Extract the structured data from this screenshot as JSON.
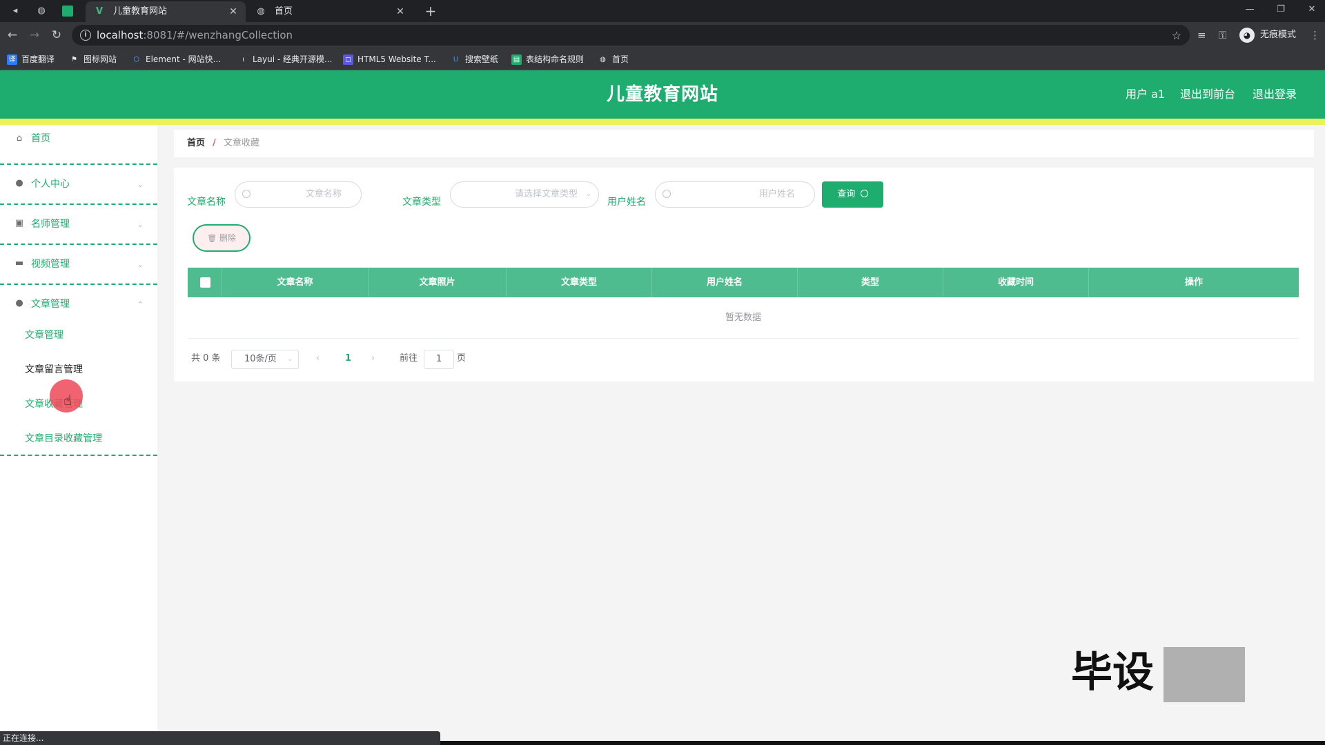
{
  "browser": {
    "tabs": [
      {
        "title": "儿童教育网站",
        "active": true,
        "icon": "vue-icon"
      },
      {
        "title": "首页",
        "active": false,
        "icon": "globe-icon"
      }
    ],
    "url_host": "localhost",
    "url_path": ":8081/#/wenzhangCollection",
    "incognito_label": "无痕模式",
    "bookmarks": [
      "百度翻译",
      "图标网站",
      "Element - 网站快...",
      "Layui - 经典开源模...",
      "HTML5 Website T...",
      "搜索壁纸",
      "表结构命名规则",
      "首页"
    ],
    "status_text": "正在连接..."
  },
  "header": {
    "title": "儿童教育网站",
    "user": "用户 a1",
    "to_front": "退出到前台",
    "logout": "退出登录"
  },
  "sidebar": {
    "items": [
      {
        "label": "首页",
        "icon": "home-icon"
      },
      {
        "label": "个人中心",
        "icon": "person-icon"
      },
      {
        "label": "名师管理",
        "icon": "badge-icon"
      },
      {
        "label": "视频管理",
        "icon": "monitor-icon"
      },
      {
        "label": "文章管理",
        "icon": "person-icon"
      }
    ],
    "sub_items": [
      "文章管理",
      "文章留言管理",
      "文章收藏管理",
      "文章目录收藏管理"
    ]
  },
  "breadcrumb": {
    "home": "首页",
    "separator": "/",
    "current": "文章收藏"
  },
  "search": {
    "title_label": "文章名称",
    "title_placeholder": "文章名称",
    "type_label": "文章类型",
    "type_placeholder": "请选择文章类型",
    "user_label": "用户姓名",
    "user_placeholder": "用户姓名",
    "query_button": "查询"
  },
  "actions": {
    "delete_button": "删除"
  },
  "table": {
    "columns": [
      "文章名称",
      "文章照片",
      "文章类型",
      "用户姓名",
      "类型",
      "收藏时间",
      "操作"
    ],
    "empty_text": "暂无数据"
  },
  "pagination": {
    "total": "共 0 条",
    "page_size": "10条/页",
    "current_page": "1",
    "goto_label": "前往",
    "goto_value": "1",
    "page_suffix": "页"
  },
  "watermark": {
    "text": "毕设"
  },
  "colors": {
    "primary": "#1fad6f",
    "header_accent": "#ecf25a",
    "table_header": "#4ebc8f"
  }
}
